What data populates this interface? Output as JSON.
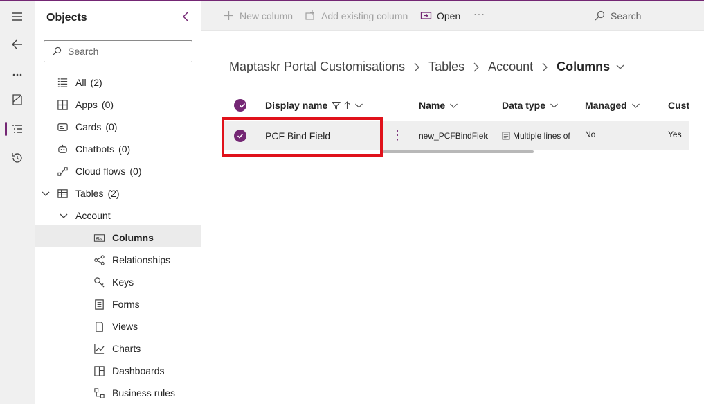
{
  "objects_panel": {
    "title": "Objects",
    "search_placeholder": "Search",
    "tree": [
      {
        "label": "All",
        "count": "(2)",
        "icon": "list-icon"
      },
      {
        "label": "Apps",
        "count": "(0)",
        "icon": "apps-icon"
      },
      {
        "label": "Cards",
        "count": "(0)",
        "icon": "card-icon"
      },
      {
        "label": "Chatbots",
        "count": "(0)",
        "icon": "chatbot-icon"
      },
      {
        "label": "Cloud flows",
        "count": "(0)",
        "icon": "flow-icon"
      },
      {
        "label": "Tables",
        "count": "(2)",
        "icon": "table-icon"
      },
      {
        "label": "Account",
        "icon": ""
      },
      {
        "label": "Columns",
        "icon": "column-icon"
      },
      {
        "label": "Relationships",
        "icon": "relationship-icon"
      },
      {
        "label": "Keys",
        "icon": "key-icon"
      },
      {
        "label": "Forms",
        "icon": "form-icon"
      },
      {
        "label": "Views",
        "icon": "view-icon"
      },
      {
        "label": "Charts",
        "icon": "chart-icon"
      },
      {
        "label": "Dashboards",
        "icon": "dashboard-icon"
      },
      {
        "label": "Business rules",
        "icon": "business-rule-icon"
      }
    ]
  },
  "command_bar": {
    "new_column": "New column",
    "add_existing_column": "Add existing column",
    "open": "Open",
    "more": "···",
    "search": "Search"
  },
  "breadcrumb": [
    "Maptaskr Portal Customisations",
    "Tables",
    "Account",
    "Columns"
  ],
  "grid": {
    "columns": [
      "Display name",
      "Name",
      "Data type",
      "Managed",
      "Custo"
    ],
    "rows": [
      {
        "display_name": "PCF Bind Field",
        "more": "⋮",
        "name": "new_PCFBindField",
        "data_type": "Multiple lines of",
        "managed": "No",
        "customizable": "Yes"
      }
    ]
  },
  "colors": {
    "accent": "#742774",
    "highlight_box": "#e0121b",
    "row_selected": "#efefef",
    "tree_selected": "#ebebeb"
  }
}
